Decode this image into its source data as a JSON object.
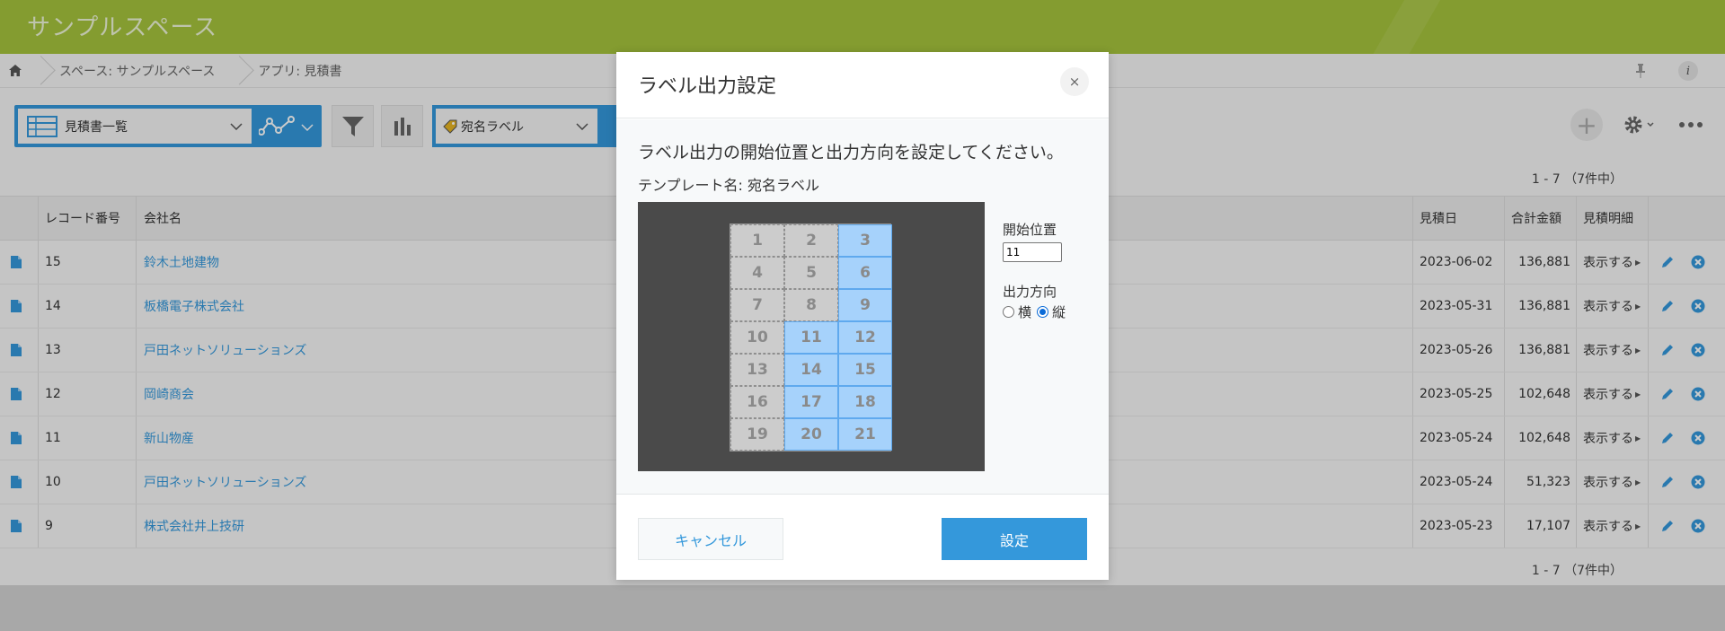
{
  "space": {
    "title": "サンプルスペース"
  },
  "breadcrumb": {
    "space": "スペース: サンプルスペース",
    "app": "アプリ: 見積書"
  },
  "toolbar": {
    "view_name": "見積書一覧",
    "label_template": "宛名ラベル"
  },
  "record_count": "1 - 7 （7件中）",
  "table": {
    "headers": {
      "record_no": "レコード番号",
      "company": "会社名",
      "date": "見積日",
      "total": "合計金額",
      "detail": "見積明細"
    },
    "rows": [
      {
        "record_no": "15",
        "company": "鈴木土地建物",
        "date": "2023-06-02",
        "total": "136,881",
        "detail": "表示する"
      },
      {
        "record_no": "14",
        "company": "板橋電子株式会社",
        "date": "2023-05-31",
        "total": "136,881",
        "detail": "表示する"
      },
      {
        "record_no": "13",
        "company": "戸田ネットソリューションズ",
        "date": "2023-05-26",
        "total": "136,881",
        "detail": "表示する"
      },
      {
        "record_no": "12",
        "company": "岡崎商会",
        "date": "2023-05-25",
        "total": "102,648",
        "detail": "表示する"
      },
      {
        "record_no": "11",
        "company": "新山物産",
        "date": "2023-05-24",
        "total": "102,648",
        "detail": "表示する"
      },
      {
        "record_no": "10",
        "company": "戸田ネットソリューションズ",
        "date": "2023-05-24",
        "total": "51,323",
        "detail": "表示する"
      },
      {
        "record_no": "9",
        "company": "株式会社井上技研",
        "date": "2023-05-23",
        "total": "17,107",
        "detail": "表示する"
      }
    ]
  },
  "dialog": {
    "title": "ラベル出力設定",
    "close_label": "×",
    "message": "ラベル出力の開始位置と出力方向を設定してください。",
    "template_name": "テンプレート名: 宛名ラベル",
    "labels": {
      "cells": [
        "1",
        "2",
        "3",
        "4",
        "5",
        "6",
        "7",
        "8",
        "9",
        "10",
        "11",
        "12",
        "13",
        "14",
        "15",
        "16",
        "17",
        "18",
        "19",
        "20",
        "21"
      ],
      "selected": [
        "3",
        "6",
        "9",
        "11",
        "12",
        "14",
        "15",
        "17",
        "18",
        "20",
        "21"
      ]
    },
    "start_position_label": "開始位置",
    "start_position_value": "11",
    "direction_label": "出力方向",
    "direction_horizontal": "横",
    "direction_vertical": "縦",
    "direction_selected": "縦",
    "cancel_label": "キャンセル",
    "ok_label": "設定"
  },
  "colors": {
    "accent": "#3498db",
    "header_bar": "#a6c43c",
    "selected_label": "#a6d2fb"
  }
}
